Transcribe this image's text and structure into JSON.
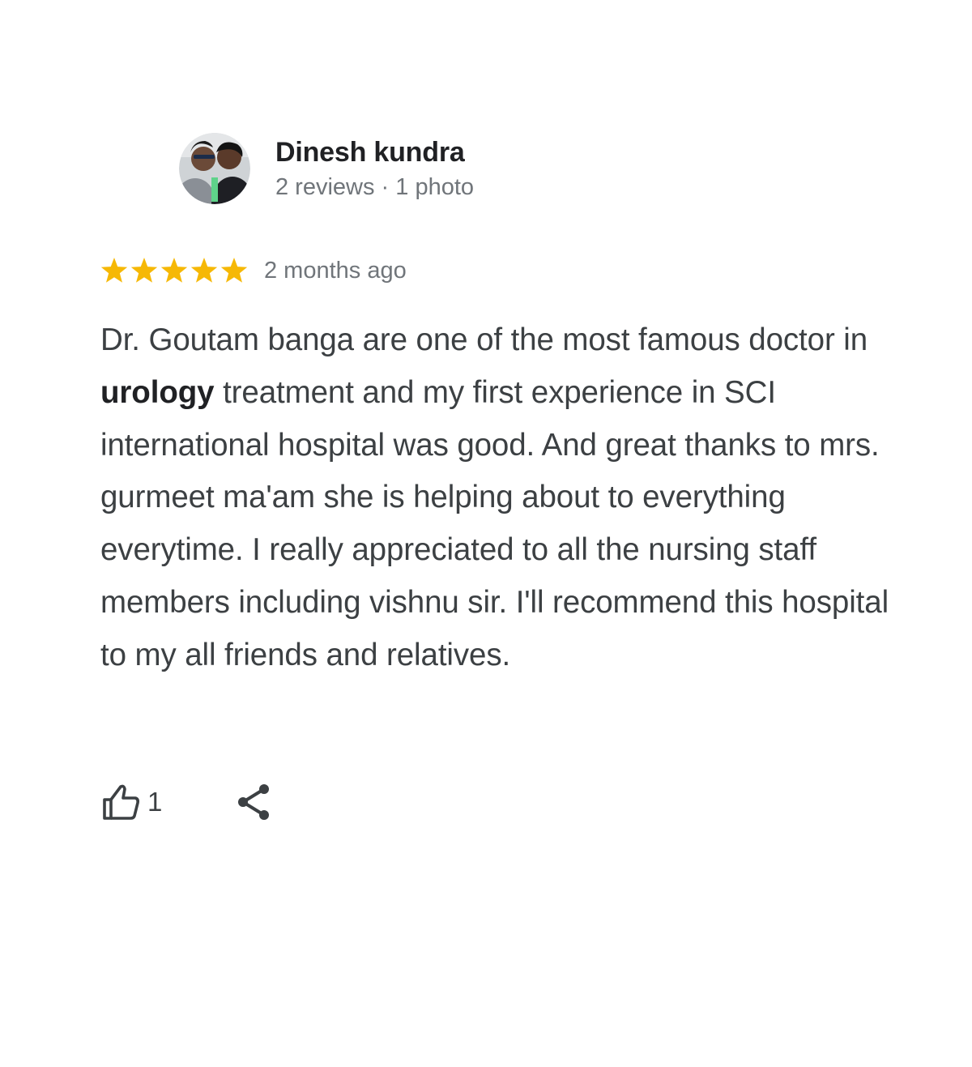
{
  "reviewer": {
    "name": "Dinesh kundra",
    "meta": "2 reviews · 1 photo",
    "avatar_icon": "profile-photo"
  },
  "rating": {
    "stars": 5,
    "max_stars": 5,
    "star_color": "#f6b805",
    "date": "2 months ago"
  },
  "review": {
    "text_before_bold": "Dr. Goutam banga are one of the most famous doctor in ",
    "bold_word": "urology",
    "text_after_bold": " treatment and my first experience in SCI international hospital was good. And great thanks to mrs. gurmeet ma'am she is helping about to everything everytime. I really appreciated to all the nursing staff members including vishnu sir. I'll recommend this hospital to my all friends and relatives."
  },
  "actions": {
    "like_icon": "thumbs-up-icon",
    "like_count": "1",
    "share_icon": "share-icon"
  },
  "colors": {
    "text": "#3c4043",
    "name": "#202124",
    "meta": "#70757a",
    "star": "#f6b805"
  }
}
